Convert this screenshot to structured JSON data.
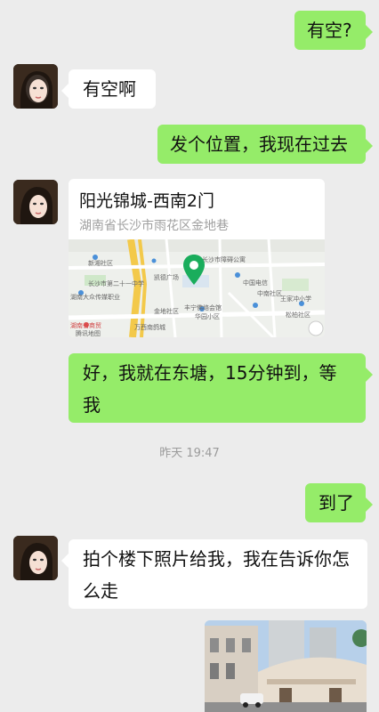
{
  "messages": {
    "m1": "有空?",
    "m2": "有空啊",
    "m3": "发个位置，我现在过去",
    "m5": "好，我就在东塘，15分钟到，等我",
    "m6": "到了",
    "m7": "拍个楼下照片给我，我在告诉你怎么走"
  },
  "location": {
    "title": "阳光锦城-西南2门",
    "address": "湖南省长沙市雨花区金地巷",
    "map_labels": {
      "l1": "新湘社区",
      "l2": "长沙市第二十一中学",
      "l3": "湖南大众传媒职业",
      "l4": "凯德广场",
      "l5": "长沙市障碍公寓",
      "l6": "中国电信",
      "l7": "中南社区",
      "l8": "王家冲小学",
      "l9": "金地社区",
      "l10": "丰宁佛络会馆",
      "l11": "华园小区",
      "l12": "万西南鸽城",
      "l13": "湖南省商贸",
      "l14": "腾讯地图",
      "l15": "松柏社区"
    }
  },
  "timestamp": "昨天 19:47",
  "colors": {
    "background": "#ececec",
    "outgoing": "#95ec69",
    "incoming": "#ffffff",
    "pin": "#1aad5c"
  }
}
